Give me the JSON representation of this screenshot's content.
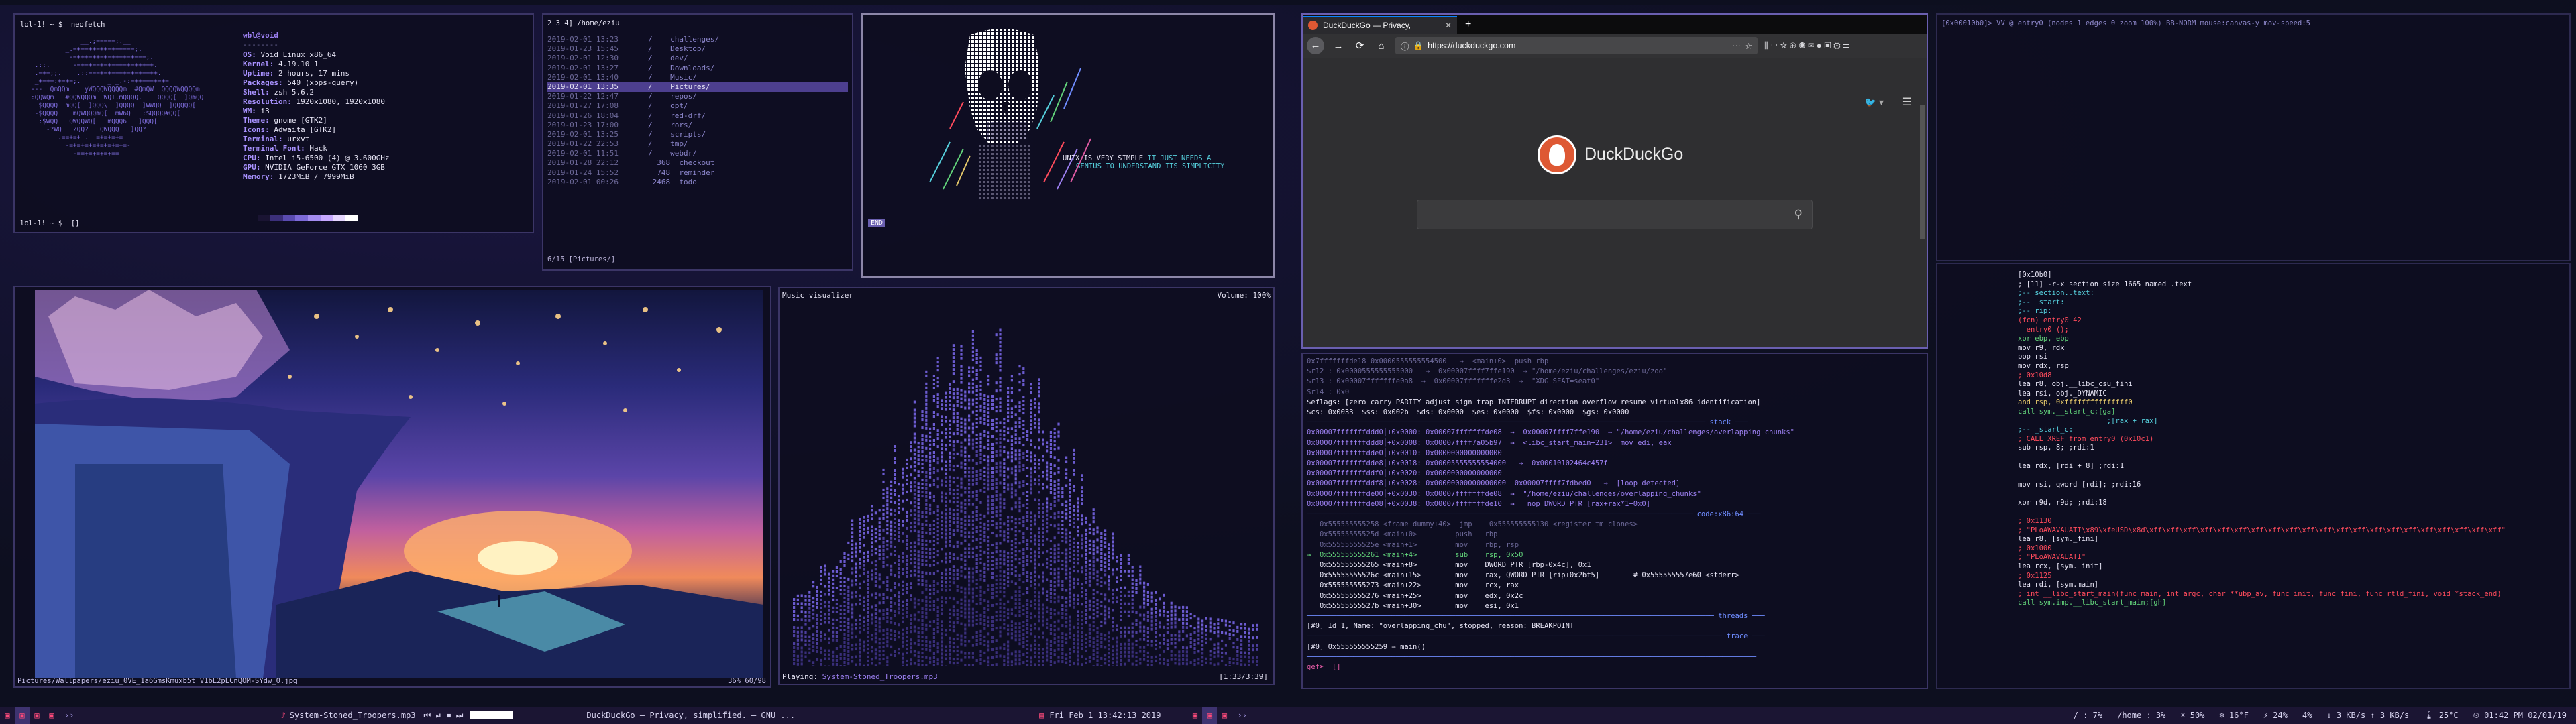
{
  "neofetch": {
    "prompt": "lol-1! ~ $  neofetch",
    "user_host": "wbl@void",
    "separator": "--------",
    "fields": [
      {
        "k": "OS:",
        "v": "Void Linux x86_64"
      },
      {
        "k": "Kernel:",
        "v": "4.19.10_1"
      },
      {
        "k": "Uptime:",
        "v": "2 hours, 17 mins"
      },
      {
        "k": "Packages:",
        "v": "540 (xbps-query)"
      },
      {
        "k": "Shell:",
        "v": "zsh 5.6.2"
      },
      {
        "k": "Resolution:",
        "v": "1920x1080, 1920x1080"
      },
      {
        "k": "WM:",
        "v": "i3"
      },
      {
        "k": "Theme:",
        "v": "gnome [GTK2]"
      },
      {
        "k": "Icons:",
        "v": "Adwaita [GTK2]"
      },
      {
        "k": "Terminal:",
        "v": "urxvt"
      },
      {
        "k": "Terminal Font:",
        "v": "Hack"
      },
      {
        "k": "CPU:",
        "v": "Intel i5-6500 (4) @ 3.600GHz"
      },
      {
        "k": "GPU:",
        "v": "NVIDIA GeForce GTX 1060 3GB"
      },
      {
        "k": "Memory:",
        "v": "1723MiB / 7999MiB"
      }
    ],
    "bar_colors": [
      "#1a1433",
      "#3b2f7a",
      "#5a4bb0",
      "#7d6ad8",
      "#a48cf0",
      "#c6a8ff",
      "#e6d6ff",
      "#ffffff"
    ],
    "end_prompt": "lol-1! ~ $  []"
  },
  "ranger": {
    "title": "2 3 4] /home/eziu",
    "rows": [
      {
        "d": "2019-02-01 13:23",
        "n": "/    challenges/"
      },
      {
        "d": "2019-01-23 15:45",
        "n": "/    Desktop/"
      },
      {
        "d": "2019-02-01 12:30",
        "n": "/    dev/"
      },
      {
        "d": "2019-02-01 13:27",
        "n": "/    Downloads/"
      },
      {
        "d": "2019-02-01 13:40",
        "n": "/    Music/"
      },
      {
        "d": "2019-02-01 13:35",
        "n": "/    Pictures/",
        "sel": true
      },
      {
        "d": "2019-01-22 12:47",
        "n": "/    repos/"
      },
      {
        "d": "2019-01-27 17:08",
        "n": "/    opt/"
      },
      {
        "d": "2019-01-26 18:04",
        "n": "/    red-drf/"
      },
      {
        "d": "2019-01-23 17:00",
        "n": "/    rors/"
      },
      {
        "d": "2019-02-01 13:25",
        "n": "/    scripts/"
      },
      {
        "d": "2019-01-22 22:53",
        "n": "/    tmp/"
      },
      {
        "d": "2019-02-01 11:51",
        "n": "/    webdr/"
      },
      {
        "d": "2019-01-28 22:12",
        "n": "  368  checkout"
      },
      {
        "d": "2019-01-24 15:52",
        "n": "  748  reminder"
      },
      {
        "d": "2019-02-01 00:26",
        "n": " 2468  todo"
      }
    ],
    "footer": "6/15 [Pictures/]"
  },
  "skull": {
    "line1a": "UNIX IS VERY SIMPLE ",
    "line1b": "IT JUST NEEDS A",
    "line2": "GENIUS TO UNDERSTAND ITS SIMPLICITY",
    "end": "END"
  },
  "browser": {
    "tab_title": "DuckDuckGo — Privacy,",
    "tab_close": "✕",
    "new_tab": "+",
    "url": "https://duckduckgo.com",
    "dots": "···",
    "brand": "DuckDuckGo",
    "twitter": "🐦 ▾",
    "menu": "☰",
    "search_icon": "⚲",
    "nav_back": "←",
    "nav_fwd": "→",
    "nav_reload": "⟳",
    "nav_home": "⌂",
    "toolbar_icons": "⫼ ▭ ☆ ⊕ ◉ ✉ ● ▣ ⚙ ☰"
  },
  "r2top": {
    "header": "[0x00010b0]> VV @ entry0 (nodes 1 edges 0 zoom 100%) BB-NORM mouse:canvas-y mov-speed:5"
  },
  "r2": {
    "lines": [
      {
        "t": "[0x10b0]",
        "c": "wht"
      },
      {
        "t": "; [11] -r-x section size 1665 named .text",
        "c": "wht"
      },
      {
        "t": ";-- section..text:",
        "c": "cy"
      },
      {
        "t": ";-- _start:",
        "c": "cy"
      },
      {
        "t": ";-- rip:",
        "c": "cy"
      },
      {
        "t": "(fcn) entry0 42",
        "c": "red"
      },
      {
        "t": "  entry0 ();",
        "c": "red"
      },
      {
        "t": "xor ebp, ebp",
        "c": "grn"
      },
      {
        "t": "mov r9, rdx",
        "c": "wht"
      },
      {
        "t": "pop rsi",
        "c": "wht"
      },
      {
        "t": "mov rdx, rsp",
        "c": "wht"
      },
      {
        "t": "; 0x10d8",
        "c": "red"
      },
      {
        "t": "lea r8, obj.__libc_csu_fini",
        "c": "wht"
      },
      {
        "t": "lea rsi, obj._DYNAMIC",
        "c": "wht"
      },
      {
        "t": "and rsp, 0xfffffffffffffff0",
        "c": "yel"
      },
      {
        "t": "call sym.__start_c;[ga]",
        "c": "grn"
      },
      {
        "t": "                     ;[rax + rax]",
        "c": "cy"
      },
      {
        "t": ";-- _start_c:",
        "c": "cy"
      },
      {
        "t": "; CALL XREF from entry0 (0x10c1)",
        "c": "red"
      },
      {
        "t": "sub rsp, 8; ;rdi:1",
        "c": "wht"
      },
      {
        "t": "",
        "c": "wht"
      },
      {
        "t": "lea rdx, [rdi + 8] ;rdi:1",
        "c": "wht"
      },
      {
        "t": "",
        "c": "wht"
      },
      {
        "t": "mov rsi, qword [rdi]; ;rdi:16",
        "c": "wht"
      },
      {
        "t": "",
        "c": "wht"
      },
      {
        "t": "xor r9d, r9d; ;rdi:18",
        "c": "wht"
      },
      {
        "t": "",
        "c": "wht"
      },
      {
        "t": "; 0x1130",
        "c": "red"
      },
      {
        "t": "; \"PLoAWAVAUATI\\x89\\xfeUSD\\x8d\\xff\\xff\\xff\\xff\\xff\\xff\\xff\\xff\\xff\\xff\\xff\\xff\\xff\\xff\\xff\\xff\\xff\\xff\\xff\\xff\\xff\"",
        "c": "red"
      },
      {
        "t": "lea r8, [sym._fini]",
        "c": "wht"
      },
      {
        "t": "; 0x1000",
        "c": "red"
      },
      {
        "t": "; \"PLoAWAVAUATI\"",
        "c": "red"
      },
      {
        "t": "lea rcx, [sym._init]",
        "c": "wht"
      },
      {
        "t": "; 0x1125",
        "c": "red"
      },
      {
        "t": "lea rdi, [sym.main]",
        "c": "wht"
      },
      {
        "t": "; int __libc_start_main(func main, int argc, char **ubp_av, func init, func fini, func rtld_fini, void *stack_end)",
        "c": "red"
      },
      {
        "t": "call sym.imp.__libc_start_main;[gh]",
        "c": "grn"
      }
    ]
  },
  "gdb": {
    "lines": [
      {
        "t": "0x7fffffffde18 0x0000555555554500   →  <main+0>  push rbp",
        "c": "dim"
      },
      {
        "t": "$r12 : 0x0000555555555000   →  0x00007ffff7ffe190  → \"/home/eziu/challenges/eziu/zoo\"",
        "c": "dim"
      },
      {
        "t": "$r13 : 0x00007fffffffe0a8  →  0x00007fffffffe2d3  →  \"XDG_SEAT=seat0\"",
        "c": "dim"
      },
      {
        "t": "$r14 : 0x0",
        "c": "dim"
      },
      {
        "t": "$eflags: [zero carry PARITY adjust sign trap INTERRUPT direction overflow resume virtualx86 identification]",
        "c": "wht"
      },
      {
        "t": "$cs: 0x0033  $ss: 0x002b  $ds: 0x0000  $es: 0x0000  $fs: 0x0000  $gs: 0x0000",
        "c": "wht"
      },
      {
        "t": "────────────────────────────────────────────────────────────────────────────────────────────── stack ───",
        "c": "blu"
      },
      {
        "t": "0x00007fffffffddd0│+0x0000: 0x00007fffffffde08  →  0x00007ffff7ffe190  → \"/home/eziu/challenges/overlapping_chunks\"",
        "c": "pur"
      },
      {
        "t": "0x00007fffffffddd8│+0x0008: 0x00007ffff7a05b97  →  <libc_start_main+231>  mov edi, eax",
        "c": "pur"
      },
      {
        "t": "0x00007fffffffdde0│+0x0010: 0x0000000000000000",
        "c": "pur"
      },
      {
        "t": "0x00007fffffffdde8│+0x0018: 0x00005555555554000   →  0x00010102464c457f",
        "c": "pur"
      },
      {
        "t": "0x00007fffffffddf0│+0x0020: 0x0000000000000000",
        "c": "pur"
      },
      {
        "t": "0x00007fffffffddf8│+0x0028: 0x00000000000000000  0x00007ffff7fdbed0   →  [loop detected]",
        "c": "pur"
      },
      {
        "t": "0x00007fffffffde00│+0x0030: 0x00007fffffffde08  →  \"/home/eziu/challenges/overlapping_chunks\"",
        "c": "pur"
      },
      {
        "t": "0x00007fffffffde08│+0x0038: 0x00007fffffffde10  →   nop DWORD PTR [rax+rax*1+0x0]",
        "c": "pur"
      },
      {
        "t": "─────────────────────────────────────────────────────────────────────────────────────────── code:x86:64 ───",
        "c": "blu"
      },
      {
        "t": "   0x555555555258 <frame_dummy+40>  jmp    0x555555555130 <register_tm_clones>",
        "c": "dim"
      },
      {
        "t": "   0x55555555525d <main+0>         push   rbp",
        "c": "dim"
      },
      {
        "t": "   0x55555555525e <main+1>         mov    rbp, rsp",
        "c": "dim"
      },
      {
        "t": "→  0x555555555261 <main+4>         sub    rsp, 0x50",
        "c": "grn"
      },
      {
        "t": "   0x555555555265 <main+8>         mov    DWORD PTR [rbp-0x4c], 0x1",
        "c": "wht"
      },
      {
        "t": "   0x55555555526c <main+15>        mov    rax, QWORD PTR [rip+0x2bf5]        # 0x555555557e60 <stderr>",
        "c": "wht"
      },
      {
        "t": "   0x555555555273 <main+22>        mov    rcx, rax",
        "c": "wht"
      },
      {
        "t": "   0x555555555276 <main+25>        mov    edx, 0x2c",
        "c": "wht"
      },
      {
        "t": "   0x55555555527b <main+30>        mov    esi, 0x1",
        "c": "wht"
      },
      {
        "t": "──────────────────────────────────────────────────────────────────────────────────────────────── threads ───",
        "c": "blu"
      },
      {
        "t": "[#0] Id 1, Name: \"overlapping_chu\", stopped, reason: BREAKPOINT",
        "c": "wht"
      },
      {
        "t": "────────────────────────────────────────────────────────────────────────────────────────────────── trace ───",
        "c": "blu"
      },
      {
        "t": "[#0] 0x555555555259 → main()",
        "c": "wht"
      },
      {
        "t": "──────────────────────────────────────────────────────────────────────────────────────────────────────────",
        "c": "blu"
      },
      {
        "t": "gef➤  []",
        "c": "pink"
      }
    ]
  },
  "music": {
    "title": "Music visualizer",
    "volume": "Volume: 100%",
    "playing_label": "Playing: ",
    "track": "System-Stoned_Troopers.mp3",
    "time": "[1:33/3:39]"
  },
  "wallpaper": {
    "path": "Pictures/Wallpapers/eziu_0VE_1a6GmsKmuxb5t V1bL2pLCnQOM-SYdw_0.jpg",
    "info": "36%  60/98"
  },
  "bar": {
    "left_ws": [
      "1",
      "2",
      "3",
      "4"
    ],
    "arrows1": "››",
    "now_playing": "System-Stoned_Troopers.mp3",
    "ctrl": "⏮ ⏯ ⏹ ⏭",
    "window_title": "DuckDuckGo — Privacy, simplified. — GNU ...",
    "date_icon": "▤",
    "date": "Fri Feb  1 13:42:13 2019",
    "right_ws": [
      "1",
      "2",
      "3"
    ],
    "arrows2": "››",
    "stats": [
      "/ : 7%",
      "/home : 3%",
      "☀ 50%",
      "❄ 16°F",
      "⚡ 24%",
      "4%",
      "↓ 3 KB/s  ↑ 3 KB/s",
      "🌡 25°C",
      "⏲ 01:42 PM 02/01/19"
    ]
  }
}
